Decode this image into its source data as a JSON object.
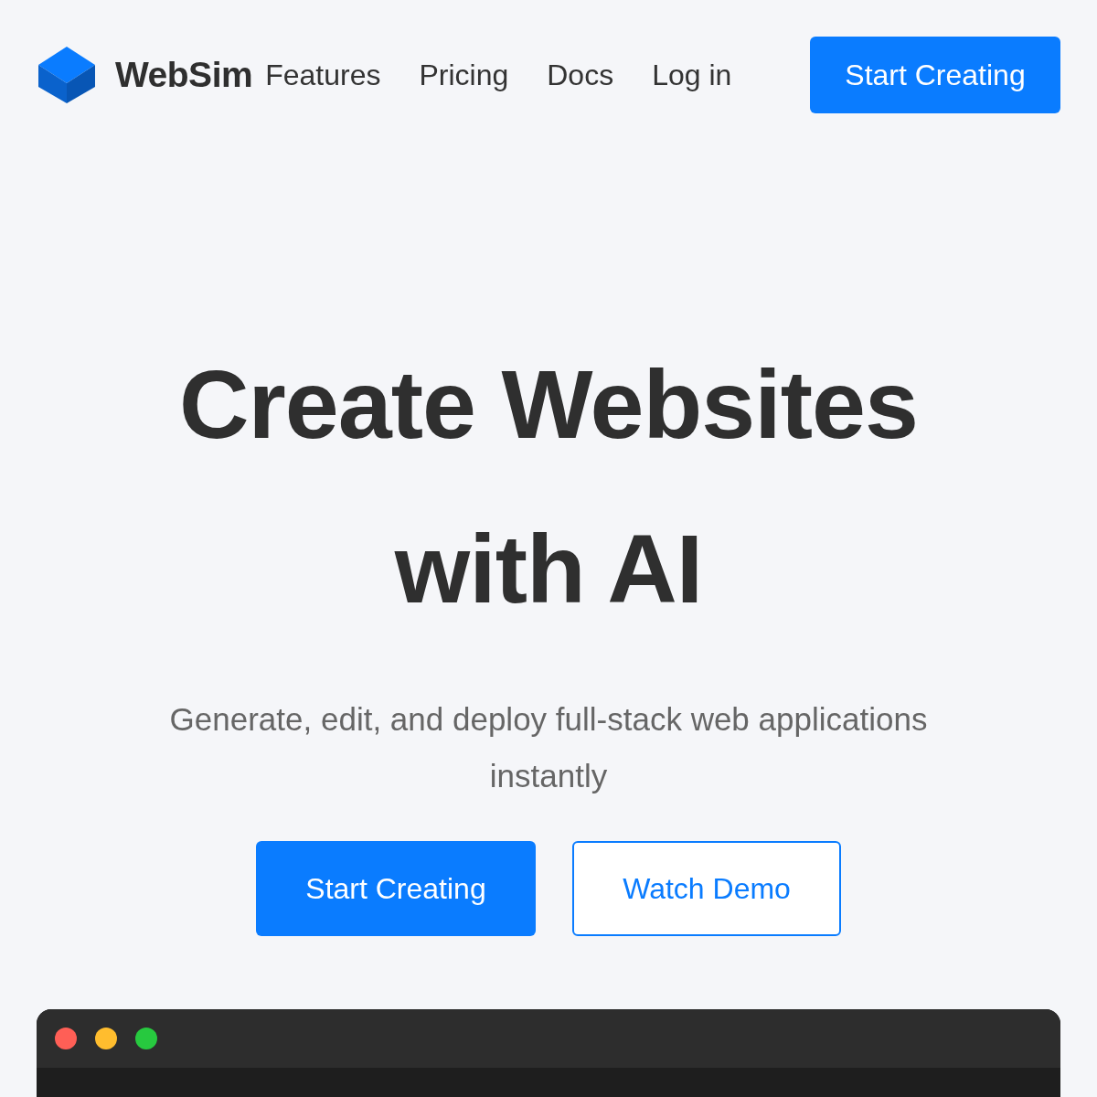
{
  "nav": {
    "brand": "WebSim",
    "links": [
      {
        "label": "Features"
      },
      {
        "label": "Pricing"
      },
      {
        "label": "Docs"
      },
      {
        "label": "Log in"
      }
    ],
    "cta": "Start Creating"
  },
  "hero": {
    "title_lines": [
      "Create Websites",
      "with AI"
    ],
    "subtitle": "Generate, edit, and deploy full-stack web applications instantly",
    "buttons": [
      {
        "label": "Start Creating",
        "kind": "primary"
      },
      {
        "label": "Watch Demo",
        "kind": "outline"
      }
    ]
  },
  "preview_window": {
    "dots": [
      {
        "color": "#ff5f56"
      },
      {
        "color": "#ffbd2e"
      },
      {
        "color": "#27c93f"
      }
    ]
  }
}
